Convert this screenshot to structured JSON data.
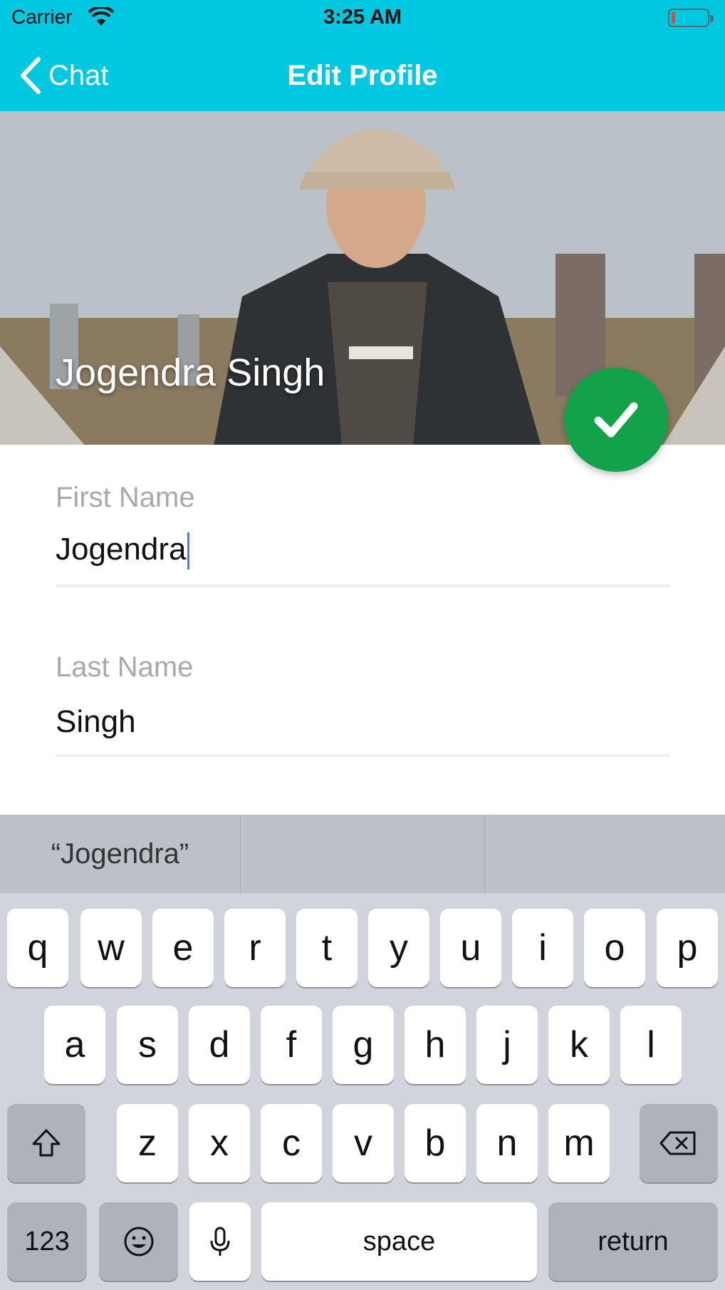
{
  "theme": {
    "accent": "#00c8e0",
    "save_button_color": "#13a24a",
    "caret_color": "#4a7bff"
  },
  "status_bar": {
    "carrier": "Carrier",
    "time": "3:25 AM",
    "battery_level_fraction": 0.1
  },
  "nav": {
    "back_label": "Chat",
    "title": "Edit Profile"
  },
  "profile": {
    "display_name": "Jogendra Singh"
  },
  "form": {
    "first_name": {
      "label": "First Name",
      "value": "Jogendra"
    },
    "last_name": {
      "label": "Last Name",
      "value": "Singh"
    }
  },
  "keyboard": {
    "suggestions": [
      "“Jogendra”",
      "",
      ""
    ],
    "row1": [
      "q",
      "w",
      "e",
      "r",
      "t",
      "y",
      "u",
      "i",
      "o",
      "p"
    ],
    "row2": [
      "a",
      "s",
      "d",
      "f",
      "g",
      "h",
      "j",
      "k",
      "l"
    ],
    "row3": [
      "z",
      "x",
      "c",
      "v",
      "b",
      "n",
      "m"
    ],
    "numbers_label": "123",
    "space_label": "space",
    "return_label": "return",
    "icons": {
      "shift": "shift-icon",
      "delete": "delete-icon",
      "emoji": "emoji-icon",
      "mic": "microphone-icon"
    }
  }
}
